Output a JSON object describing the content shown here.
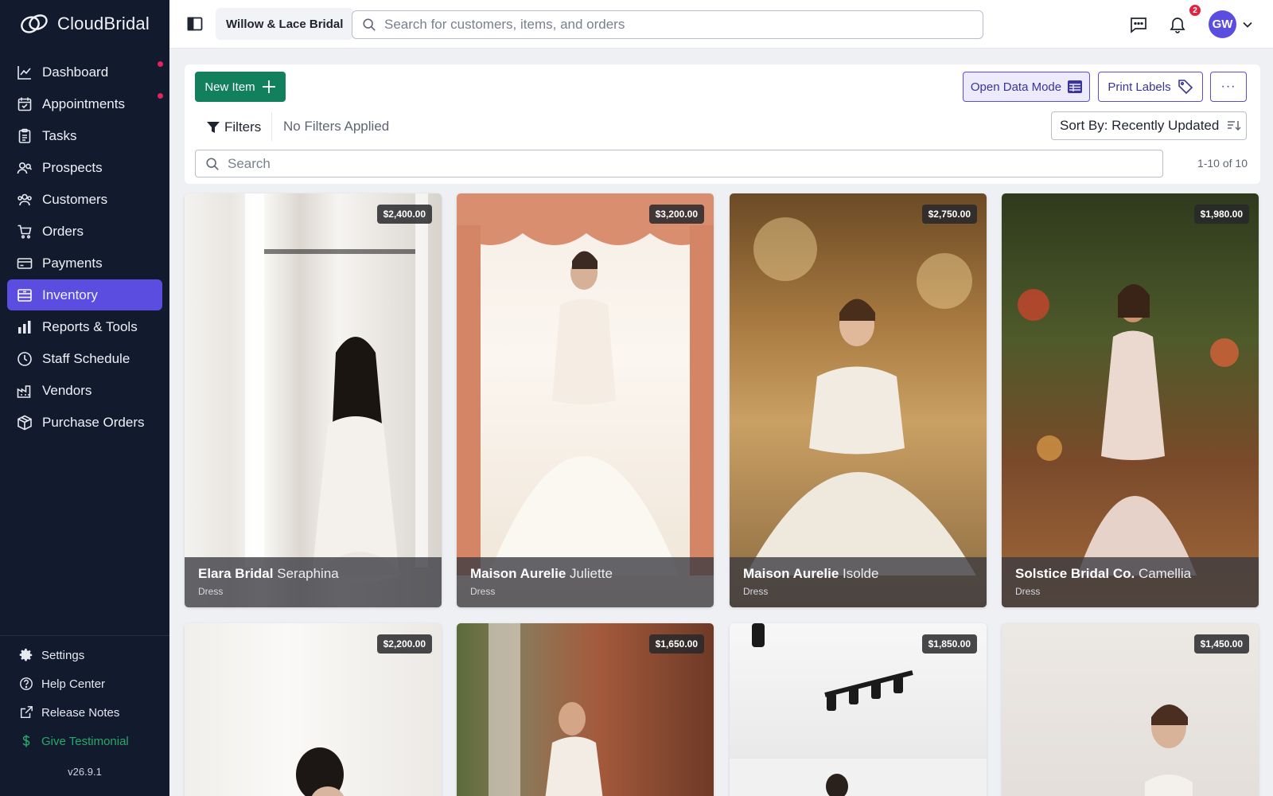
{
  "app": {
    "logo_text": "CloudBridal",
    "version": "v26.9.1"
  },
  "sidebar": {
    "items": [
      {
        "label": "Dashboard",
        "icon": "chart-line-icon",
        "dot": true
      },
      {
        "label": "Appointments",
        "icon": "calendar-check-icon",
        "dot": true
      },
      {
        "label": "Tasks",
        "icon": "clipboard-icon",
        "dot": false
      },
      {
        "label": "Prospects",
        "icon": "users-search-icon",
        "dot": false
      },
      {
        "label": "Customers",
        "icon": "users-icon",
        "dot": false
      },
      {
        "label": "Orders",
        "icon": "cart-icon",
        "dot": false
      },
      {
        "label": "Payments",
        "icon": "credit-card-icon",
        "dot": false
      },
      {
        "label": "Inventory",
        "icon": "inventory-box-icon",
        "dot": false,
        "active": true
      },
      {
        "label": "Reports & Tools",
        "icon": "bar-chart-icon",
        "dot": false
      },
      {
        "label": "Staff Schedule",
        "icon": "clock-icon",
        "dot": false
      },
      {
        "label": "Vendors",
        "icon": "factory-icon",
        "dot": false
      },
      {
        "label": "Purchase Orders",
        "icon": "package-icon",
        "dot": false
      }
    ],
    "bottom": [
      {
        "label": "Settings",
        "icon": "gear-icon"
      },
      {
        "label": "Help Center",
        "icon": "help-circle-icon"
      },
      {
        "label": "Release Notes",
        "icon": "external-link-icon"
      },
      {
        "label": "Give Testimonial",
        "icon": "dollar-icon"
      }
    ]
  },
  "header": {
    "store_name": "Willow & Lace Bridal",
    "search_placeholder": "Search for customers, items, and orders",
    "notification_count": "2",
    "avatar_initials": "GW"
  },
  "toolbar": {
    "new_item_label": "New Item",
    "open_data_mode_label": "Open Data Mode",
    "print_labels_label": "Print Labels",
    "more_label": "···",
    "filters_label": "Filters",
    "no_filters_label": "No Filters Applied",
    "sort_label": "Sort By: Recently Updated",
    "search_placeholder": "Search",
    "pagination": "1-10 of 10"
  },
  "colors": {
    "accent": "#5a4de0",
    "primary_green": "#12805c",
    "sidebar_bg": "#121a2e",
    "badge_red": "#e0243f"
  },
  "items": [
    {
      "price": "$2,400.00",
      "brand": "Elara Bridal",
      "model": "Seraphina",
      "type": "Dress"
    },
    {
      "price": "$3,200.00",
      "brand": "Maison Aurelie",
      "model": "Juliette",
      "type": "Dress"
    },
    {
      "price": "$2,750.00",
      "brand": "Maison Aurelie",
      "model": "Isolde",
      "type": "Dress"
    },
    {
      "price": "$1,980.00",
      "brand": "Solstice Bridal Co.",
      "model": "Camellia",
      "type": "Dress"
    },
    {
      "price": "$2,200.00"
    },
    {
      "price": "$1,650.00"
    },
    {
      "price": "$1,850.00"
    },
    {
      "price": "$1,450.00"
    }
  ]
}
